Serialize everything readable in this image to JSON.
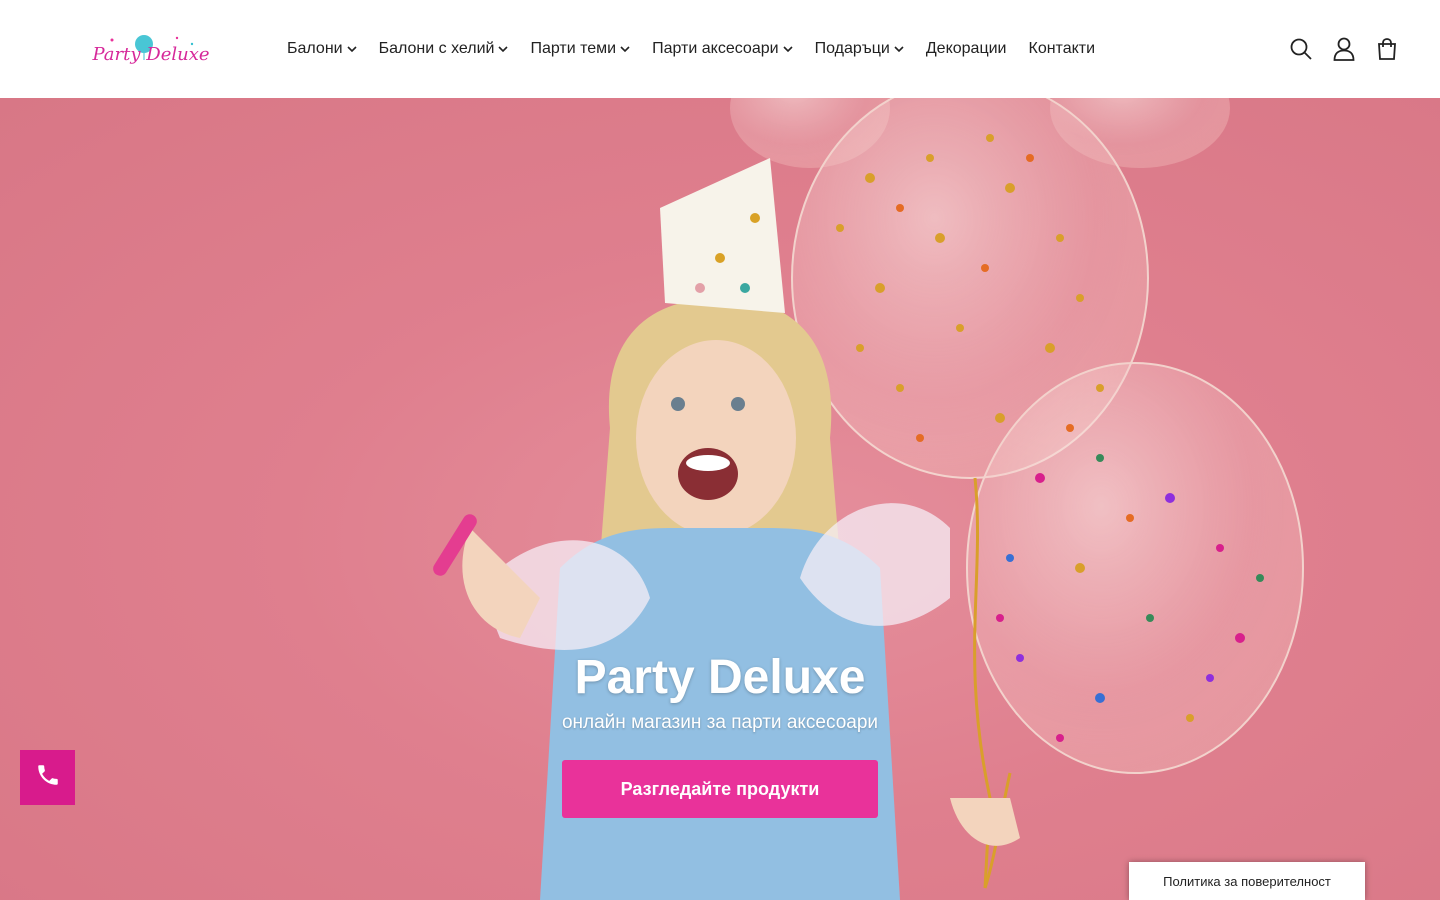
{
  "header": {
    "logo_text": "Party Deluxe",
    "nav": [
      {
        "label": "Балони",
        "has_dropdown": true,
        "icon": "chevron-down-icon"
      },
      {
        "label": "Балони с хелий",
        "has_dropdown": true,
        "icon": "chevron-down-icon"
      },
      {
        "label": "Парти теми",
        "has_dropdown": true,
        "icon": "chevron-down-icon"
      },
      {
        "label": "Парти аксесоари",
        "has_dropdown": true,
        "icon": "chevron-down-icon"
      },
      {
        "label": "Подаръци",
        "has_dropdown": true,
        "icon": "chevron-down-icon"
      },
      {
        "label": "Декорации",
        "has_dropdown": false
      },
      {
        "label": "Контакти",
        "has_dropdown": false
      }
    ],
    "icons": [
      "search-icon",
      "account-icon",
      "shopping-bag-icon"
    ]
  },
  "hero": {
    "title": "Party Deluxe",
    "subtitle": "онлайн магазин за парти аксесоари",
    "cta_label": "Разгледайте продукти"
  },
  "floating": {
    "phone_icon": "phone-icon",
    "privacy_label": "Политика за поверителност"
  },
  "colors": {
    "accent": "#e9329a",
    "phone_button": "#d81b8c",
    "hero_background": "#df7f8e",
    "logo_pink": "#d6289a"
  }
}
